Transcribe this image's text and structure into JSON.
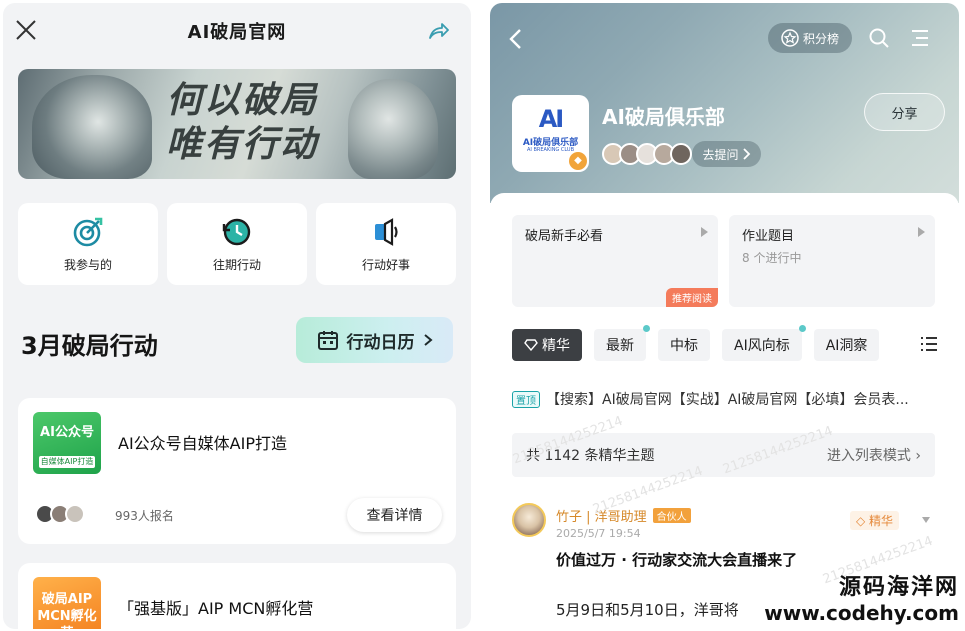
{
  "left": {
    "title": "AI破局官网",
    "banner_line1": "何以破局",
    "banner_line2": "唯有行动",
    "tiles": [
      {
        "label": "我参与的",
        "icon": "target-icon"
      },
      {
        "label": "往期行动",
        "icon": "history-clock-icon"
      },
      {
        "label": "行动好事",
        "icon": "speaker-icon"
      }
    ],
    "section_title": "3月破局行动",
    "calendar_label": "行动日历",
    "cards": [
      {
        "thumb_title": "AI公众号",
        "thumb_sub": "自媒体AIP打造",
        "name": "AI公众号自媒体AIP打造",
        "signup": "993人报名",
        "detail": "查看详情"
      },
      {
        "thumb_title": "破局AIP\nMCN孵化营",
        "name": "「强基版」AIP MCN孵化营"
      }
    ]
  },
  "right": {
    "rank_label": "积分榜",
    "club_logo_mark": "AI",
    "club_logo_name": "AI破局俱乐部",
    "club_logo_en": "AI BREAKING CLUB",
    "club_name": "AI破局俱乐部",
    "ask_label": "去提问",
    "share_label": "分享",
    "panels": [
      {
        "title": "破局新手必看",
        "tag": "推荐阅读"
      },
      {
        "title": "作业题目",
        "sub": "8 个进行中"
      }
    ],
    "tabs": [
      "精华",
      "最新",
      "中标",
      "AI风向标",
      "AI洞察"
    ],
    "pinned_badge": "置顶",
    "pinned_text": "【搜索】AI破局官网【实战】AI破局官网【必填】会员表...",
    "count_text": "共 1142 条精华主题",
    "list_mode": "进入列表模式",
    "post": {
      "author": "竹子 | 洋哥助理",
      "role": "合伙人",
      "time": "2025/5/7 19:54",
      "essence": "精华",
      "title": "价值过万 · 行动家交流大会直播来了",
      "body": "5月9日和5月10日，洋哥将"
    },
    "watermark": "21258144252214"
  },
  "site_watermark": {
    "line1": "源码海洋网",
    "line2": "www.codehy.com"
  }
}
